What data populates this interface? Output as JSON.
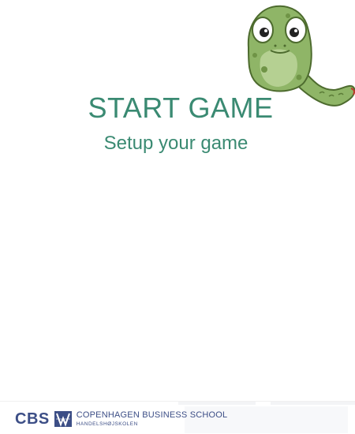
{
  "main": {
    "title": "START GAME",
    "subtitle": "Setup your game"
  },
  "footer": {
    "logo_abbrev": "CBS",
    "logo_name": "COPENHAGEN BUSINESS SCHOOL",
    "logo_subname": "HANDELSHØJSKOLEN"
  },
  "colors": {
    "accent": "#3a8a72",
    "brand": "#3c4e86",
    "mascot_body": "#8fb567"
  },
  "icons": {
    "mascot": "snake-mascot-icon",
    "logo_mark": "cbs-logo-icon"
  }
}
